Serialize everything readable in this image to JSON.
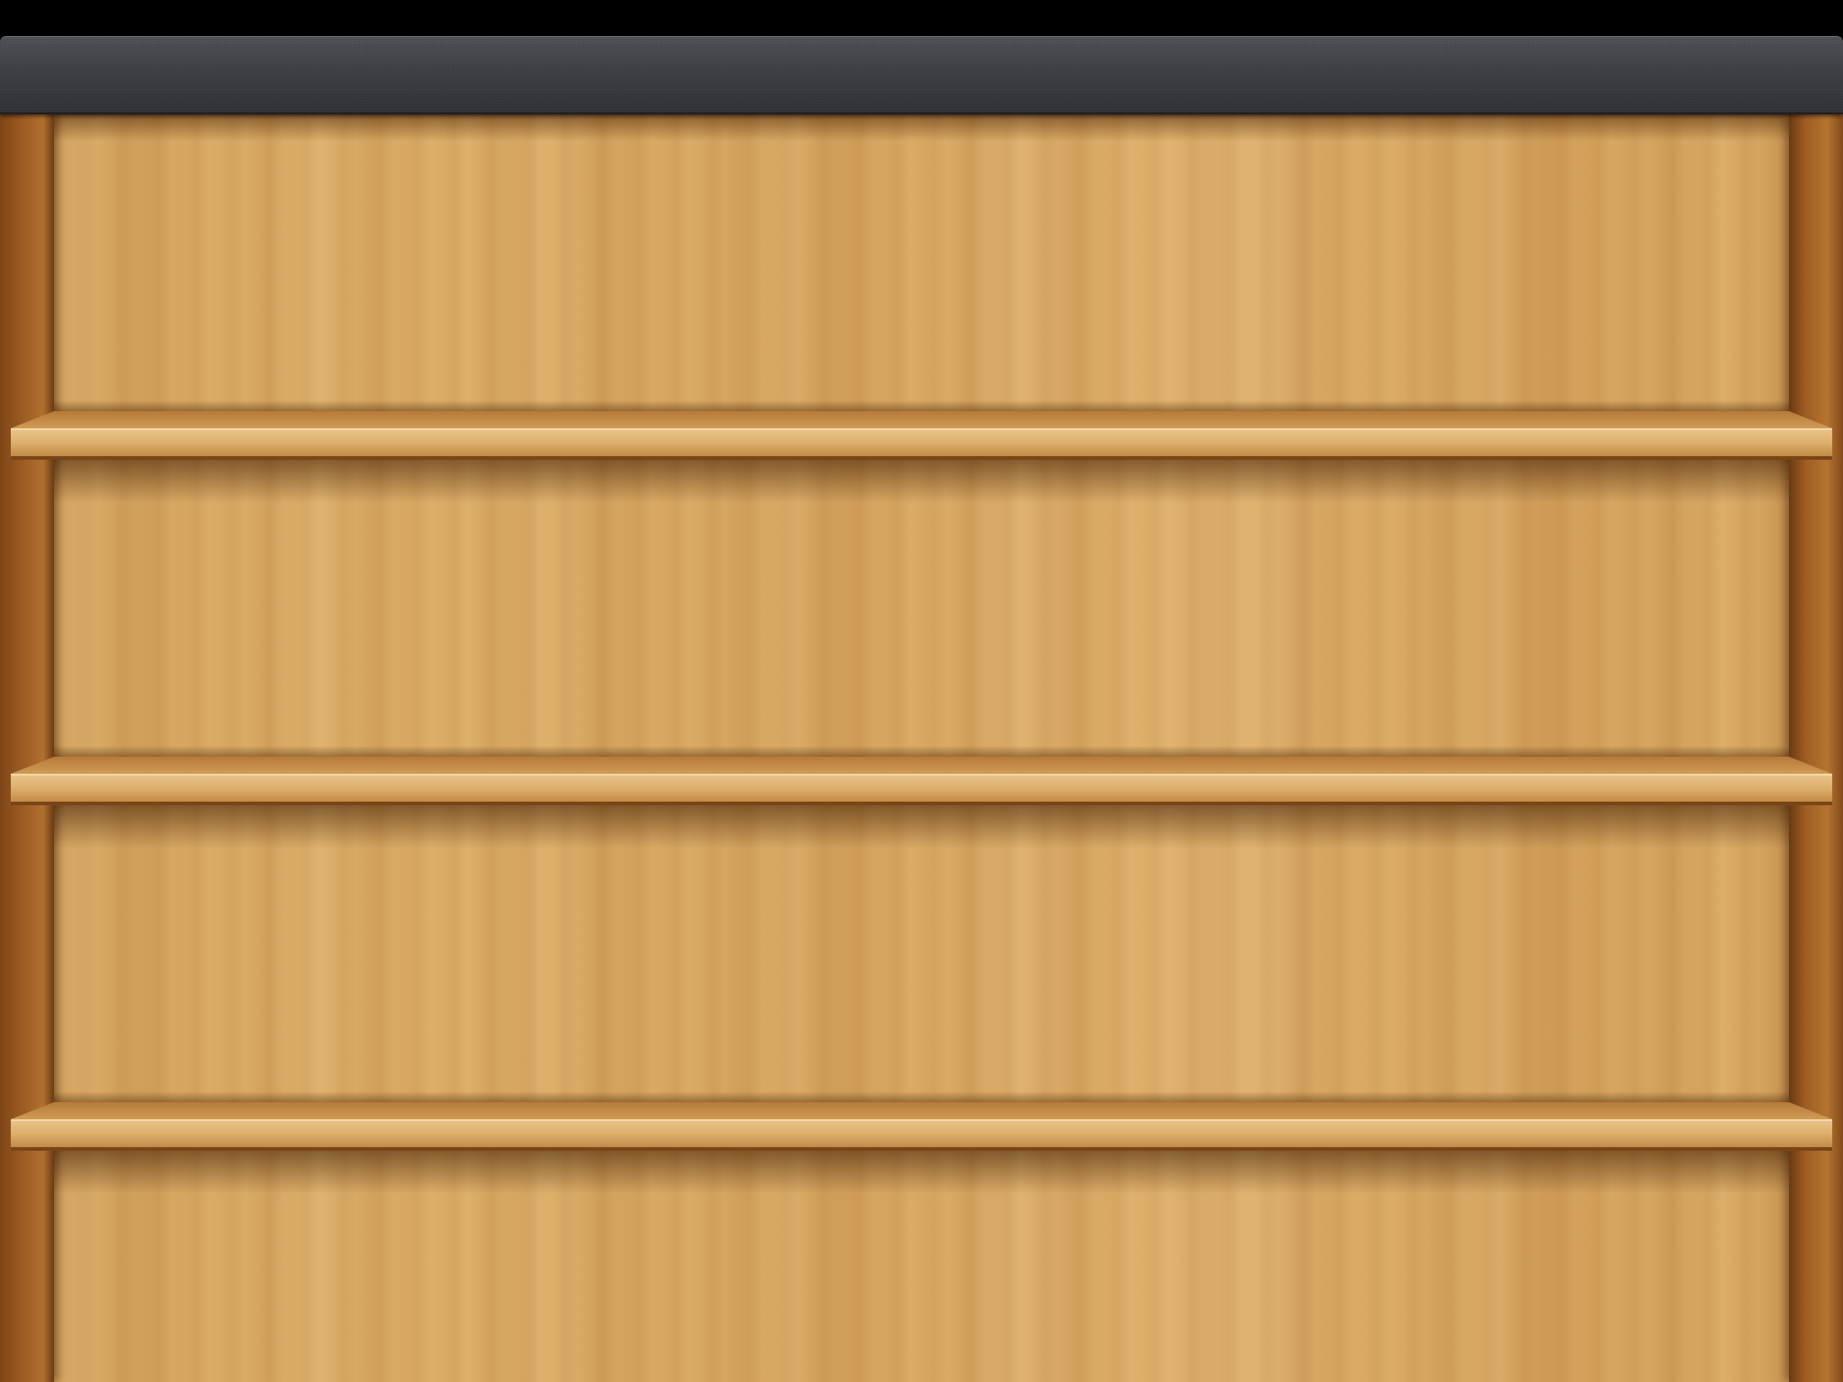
{
  "app": {
    "screen": "bookshelf",
    "books": []
  },
  "toolbar": {
    "title": ""
  },
  "bookcase": {
    "shelf_count": 3,
    "colors": {
      "toolbar_top": "#4f5257",
      "toolbar_bottom": "#2e3135",
      "wood_light": "#dfb16d",
      "wood_mid": "#d3a25d",
      "wood_dark": "#7e4617",
      "shelf_face": "#d9ad6c"
    }
  }
}
